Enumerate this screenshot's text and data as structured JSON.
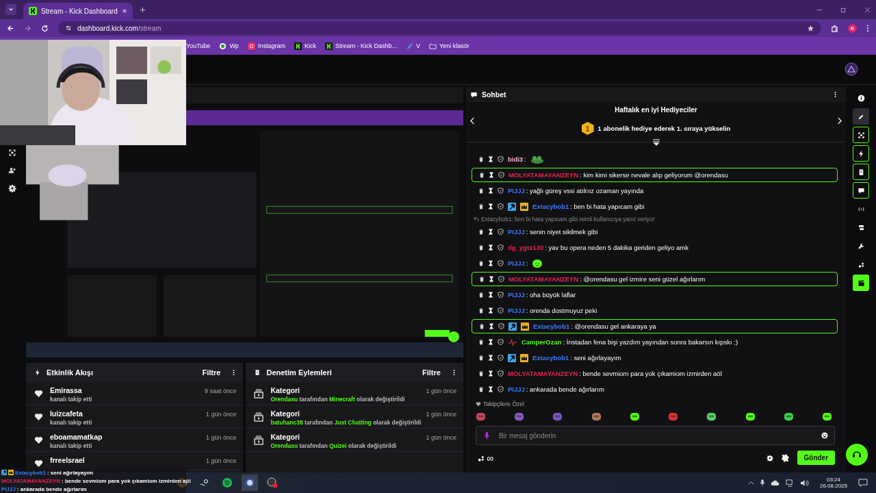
{
  "browser": {
    "tab_title": "Stream - Kick Dashboard",
    "url_host": "dashboard.kick.com",
    "url_path": "/stream",
    "profile": "B",
    "bookmarks": [
      {
        "kind": "none",
        "label": "YouTube"
      },
      {
        "kind": "whatsapp",
        "label": "Wp"
      },
      {
        "kind": "instagram",
        "label": "Instagram"
      },
      {
        "kind": "kick",
        "label": "Kick"
      },
      {
        "kind": "kick",
        "label": "Stream - Kick Dashb..."
      },
      {
        "kind": "feather",
        "label": "V"
      },
      {
        "kind": "folder",
        "label": "Yeni klasör"
      }
    ]
  },
  "activity": {
    "title": "Etkinlik Akışı",
    "filter": "Filtre",
    "items": [
      {
        "name": "Emirassa",
        "action": "kanalı takip etti",
        "time": "9 saat önce"
      },
      {
        "name": "luizcafeta",
        "action": "kanalı takip etti",
        "time": "1 gün önce"
      },
      {
        "name": "eboamamatkap",
        "action": "kanalı takip etti",
        "time": "1 gün önce"
      },
      {
        "name": "frreelsrael",
        "time": "1 gün önce"
      }
    ]
  },
  "moderation": {
    "title": "Denetim Eylemleri",
    "filter": "Filtre",
    "items": [
      {
        "title": "Kategori",
        "actor": "Orendasu",
        "middle": "tarafından",
        "category": "Minecraft",
        "suffix": "olarak değiştirildi",
        "time": "1 gün önce"
      },
      {
        "title": "Kategori",
        "actor": "batuhanc38",
        "middle": "tarafından",
        "category": "Just Chatting",
        "suffix": "olarak değiştirildi",
        "time": "1 gün önce"
      },
      {
        "title": "Kategori",
        "actor": "Orendasu",
        "middle": "tarafından",
        "category": "Quizei",
        "suffix": "olarak değiştirildi",
        "time": "1 gün önce"
      }
    ]
  },
  "chat": {
    "title": "Sohbet",
    "leaderboard_title": "Haftalık en iyi Hediyeciler",
    "rank": "1",
    "leaderboard_text": "1 abonelik hediye ederek 1. sıraya yükselin",
    "messages": [
      {
        "kind": "emote",
        "highlighted": false,
        "user": "bidi3",
        "color": "#ffb3c8",
        "text": ":",
        "emote": {
          "kind": "frog"
        }
      },
      {
        "kind": "text",
        "highlighted": true,
        "user": "MOLYATAMAYANZEYN",
        "color": "#e8224f",
        "text": ": kim kimi sikerse nevale alıp geliyorum @orendasu"
      },
      {
        "kind": "text",
        "highlighted": false,
        "user": "PIJJJ",
        "color": "#3d7bff",
        "text": ": yağlı güreş vssi atılrıız ozaman yayında"
      },
      {
        "kind": "text",
        "highlighted": false,
        "user": "Extacybob1",
        "color": "#3d7bff",
        "badges": [
          {
            "kind": "hammer"
          },
          {
            "kind": "crown"
          }
        ],
        "text": ": ben bi hata yapıcam gibi"
      },
      {
        "kind": "reply",
        "text": "Extacybob1: ben bi hata yapıcam gibi isimli kullanıcıya yanıt veriyor"
      },
      {
        "kind": "text",
        "highlighted": false,
        "user": "PIJJJ",
        "color": "#3d7bff",
        "text": ": senin niyet sikilmek gibi"
      },
      {
        "kind": "text",
        "highlighted": false,
        "user": "dg_ygtx130",
        "color": "#e8224f",
        "text": ": yav bu opera neden 5 dakika geriden geliyo amk"
      },
      {
        "kind": "emote",
        "highlighted": false,
        "user": "PIJJJ",
        "color": "#3d7bff",
        "text": ":",
        "emote": {
          "kind": "blob"
        }
      },
      {
        "kind": "text",
        "highlighted": true,
        "user": "MOLYATAMAYANZEYN",
        "color": "#e8224f",
        "text": ": @orendasu gel izmire seni güzel ağırlarım"
      },
      {
        "kind": "text",
        "highlighted": false,
        "user": "PIJJJ",
        "color": "#3d7bff",
        "text": ": oha büyük laflar"
      },
      {
        "kind": "text",
        "highlighted": false,
        "user": "PIJJJ",
        "color": "#3d7bff",
        "text": ": orenda dostmuyuz peki"
      },
      {
        "kind": "text",
        "highlighted": true,
        "user": "Extacybob1",
        "color": "#3d7bff",
        "badges": [
          {
            "kind": "hammer"
          },
          {
            "kind": "crown"
          }
        ],
        "text": ": @orendasu gel ankaraya ya"
      },
      {
        "kind": "text",
        "highlighted": false,
        "user": "CamperOzan",
        "color": "#53fc18",
        "badges": [
          {
            "kind": "pulse"
          }
        ],
        "text": ": İnstadan fena bişi yazdım yayından sonra bakarsın kıpskı ;)"
      },
      {
        "kind": "text",
        "highlighted": false,
        "user": "Extacybob1",
        "color": "#3d7bff",
        "badges": [
          {
            "kind": "hammer"
          },
          {
            "kind": "crown"
          }
        ],
        "text": ": seni ağırlayayım"
      },
      {
        "kind": "text",
        "highlighted": false,
        "user": "MOLYATAMAYANZEYN",
        "color": "#e8224f",
        "text": ": bende sevmiom para yok çıkamiom izmirden aöl"
      },
      {
        "kind": "text",
        "highlighted": false,
        "user": "PIJJJ",
        "color": "#3d7bff",
        "text": ": ankarada bende ağırlarım"
      }
    ],
    "emotes_label": "Takipçilere Özel",
    "input_placeholder": "Bir mesaj gönderin",
    "infinity": "∞",
    "send": "Gönder"
  },
  "rail": [
    {
      "kind": "info",
      "selected": false,
      "pinned": false,
      "active": false
    },
    {
      "kind": "pencil",
      "selected": true,
      "pinned": false,
      "active": false
    },
    {
      "kind": "frame",
      "selected": false,
      "pinned": true,
      "active": false
    },
    {
      "kind": "bolt",
      "selected": false,
      "pinned": true,
      "active": false
    },
    {
      "kind": "note",
      "selected": false,
      "pinned": true,
      "active": false
    },
    {
      "kind": "chat",
      "selected": false,
      "pinned": true,
      "active": false
    },
    {
      "kind": "broadcast",
      "selected": false,
      "pinned": false,
      "active": false
    },
    {
      "kind": "monitor",
      "selected": false,
      "pinned": false,
      "active": false
    },
    {
      "kind": "wrench",
      "selected": false,
      "pinned": false,
      "active": false
    },
    {
      "kind": "dots",
      "selected": false,
      "pinned": false,
      "active": false
    },
    {
      "kind": "clapper",
      "selected": false,
      "pinned": false,
      "active": true
    }
  ],
  "overlay": [
    {
      "user": "Extacybob1",
      "color": "#3d7bff",
      "badges": [
        {
          "kind": "hammer"
        },
        {
          "kind": "crown"
        }
      ],
      "text": ": seni ağırlayayım"
    },
    {
      "user": "MOLYATAMAYANZEYN",
      "color": "#e8224f",
      "text": ": bende sevmiom para yok çıkamiom izmirden aöl"
    },
    {
      "user": "PIJJJ",
      "color": "#3d7bff",
      "text": ": ankarada bende ağırlarım"
    }
  ],
  "taskbar": {
    "time": "03:24",
    "date": "26.08.2025"
  }
}
